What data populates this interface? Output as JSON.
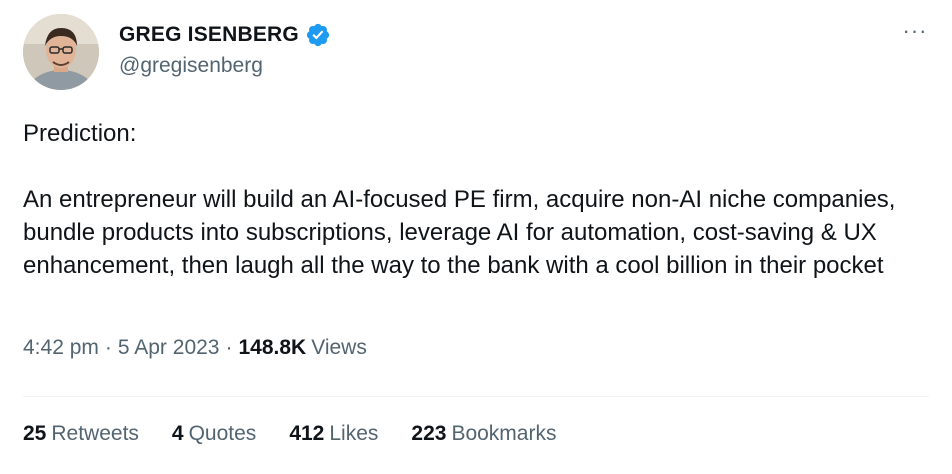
{
  "author": {
    "display_name": "GREG ISENBERG",
    "handle": "@gregisenberg",
    "verified_icon": "verified-badge-icon",
    "verified_color": "#1d9bf0"
  },
  "more_icon": "more-horizontal-icon",
  "more_label": "···",
  "tweet": {
    "paragraphs": [
      "Prediction:",
      "An entrepreneur will build an AI-focused PE firm, acquire non-AI niche companies, bundle products into subscriptions, leverage AI for automation, cost-saving & UX enhancement, then laugh all the way to the bank with a cool billion in their pocket"
    ]
  },
  "meta": {
    "time": "4:42 pm",
    "separator": "·",
    "date": "5 Apr 2023",
    "views_count": "148.8K",
    "views_label": "Views"
  },
  "stats": {
    "retweets": {
      "count": "25",
      "label": "Retweets"
    },
    "quotes": {
      "count": "4",
      "label": "Quotes"
    },
    "likes": {
      "count": "412",
      "label": "Likes"
    },
    "bookmarks": {
      "count": "223",
      "label": "Bookmarks"
    }
  },
  "colors": {
    "text_primary": "#0f1419",
    "text_secondary": "#536471",
    "divider": "#eff3f4"
  }
}
